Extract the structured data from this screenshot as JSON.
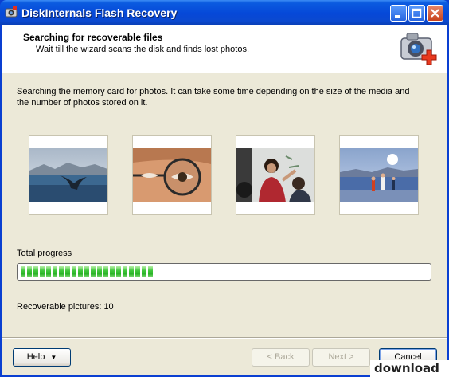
{
  "window": {
    "title": "DiskInternals Flash Recovery"
  },
  "header": {
    "title": "Searching for recoverable files",
    "subtitle": "Wait till the wizard scans the disk and finds lost photos."
  },
  "description": "Searching the memory card for photos. It can take some time depending on the size of the media and the number of photos stored on it.",
  "thumbnails": [
    {
      "icon": "whale-tail-photo"
    },
    {
      "icon": "eyeglasses-photo"
    },
    {
      "icon": "classroom-photo"
    },
    {
      "icon": "beach-photo"
    }
  ],
  "progress": {
    "label": "Total progress",
    "value_fraction": 0.33
  },
  "recoverable": {
    "text": "Recoverable pictures: 10"
  },
  "buttons": {
    "help": "Help",
    "back": "< Back",
    "next": "Next >",
    "cancel": "Cancel"
  },
  "watermark": {
    "text": "download"
  },
  "colors": {
    "titlebar": "#0648d8",
    "progress_fill": "#3fc63a",
    "client": "#ece9d8"
  }
}
